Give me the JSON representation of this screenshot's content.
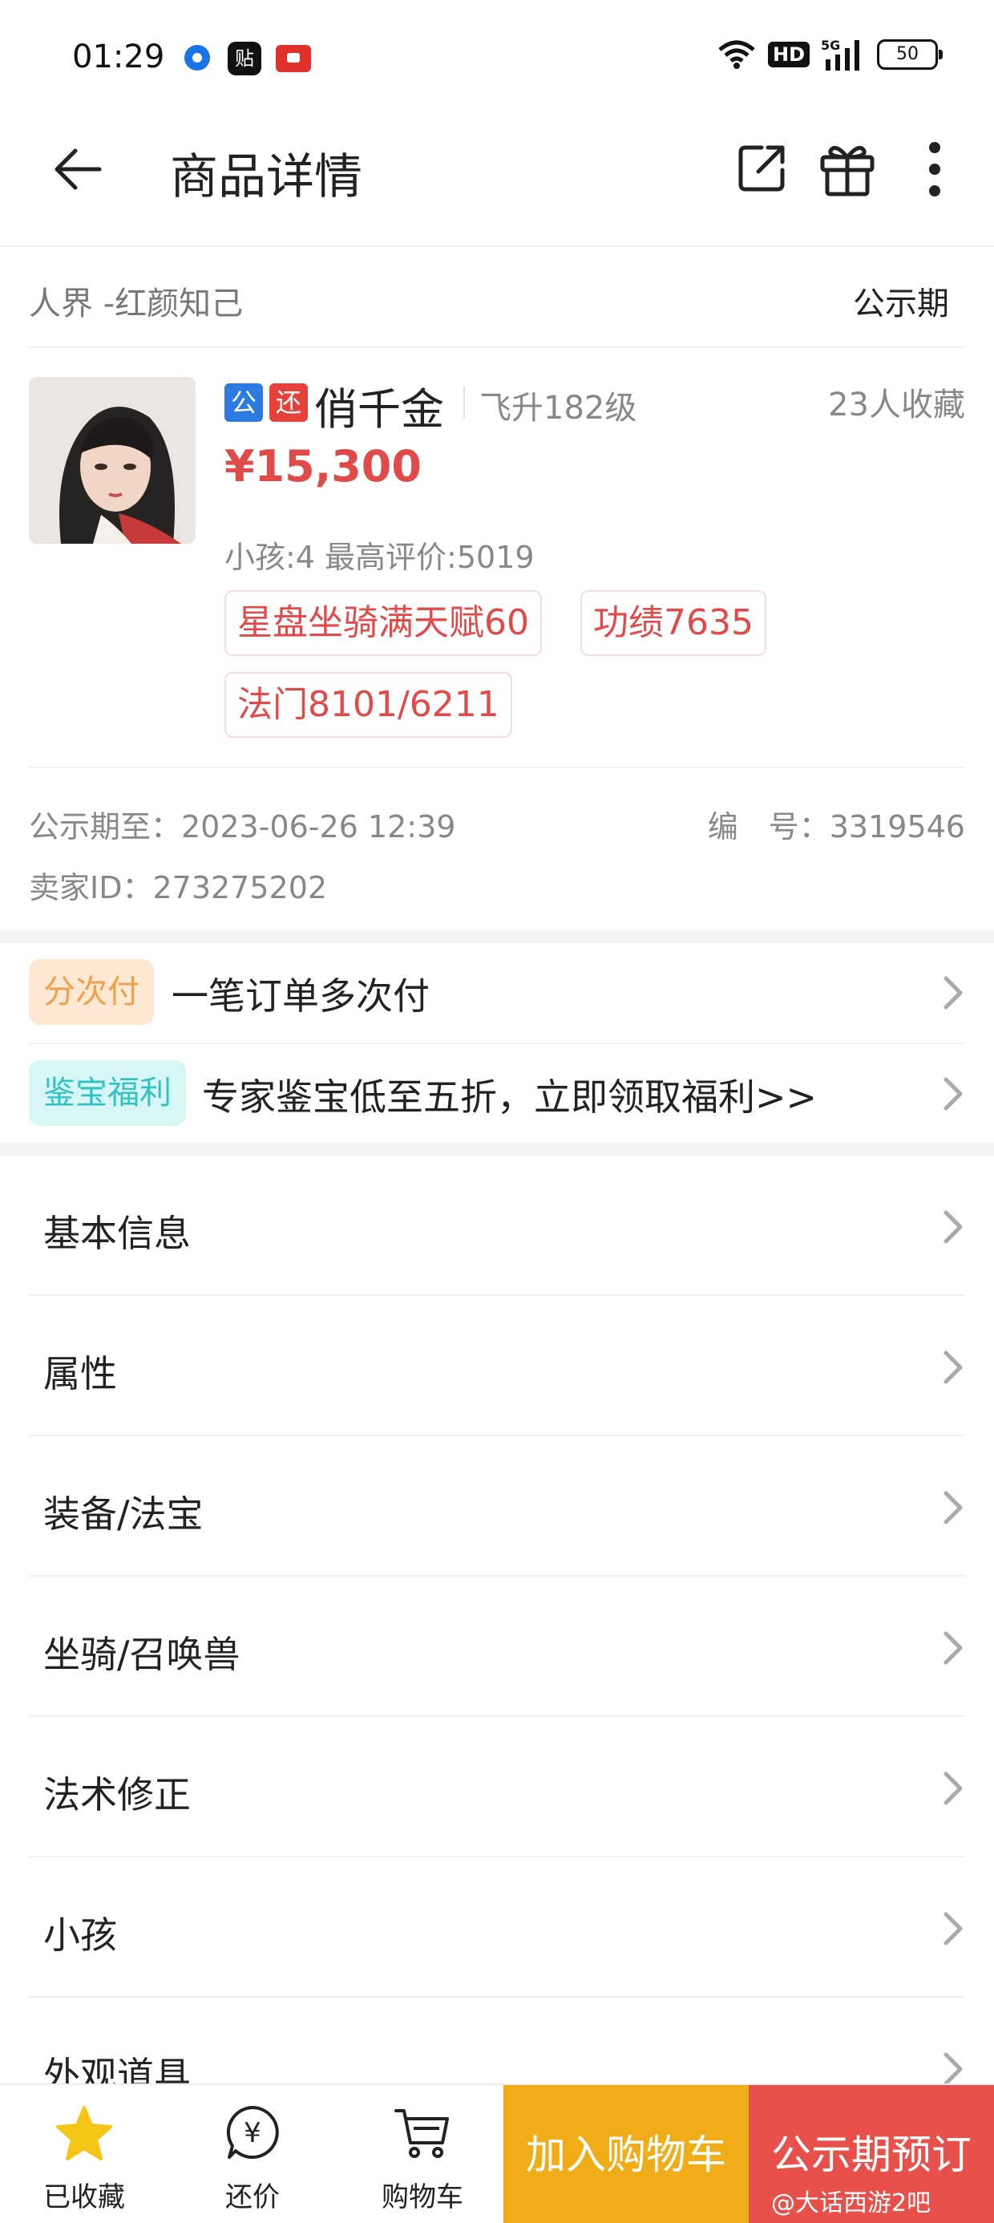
{
  "status_bar": {
    "time": "01:29",
    "tieba_glyph": "贴",
    "hd_label": "HD",
    "net_label": "5G",
    "battery": "50"
  },
  "nav": {
    "title": "商品详情",
    "icons": [
      "back-arrow-icon",
      "share-icon",
      "gift-icon",
      "more-vertical-icon"
    ]
  },
  "server_row": {
    "server_name": "人界 -红颜知己",
    "status": "公示期"
  },
  "product": {
    "tag_public": "公",
    "tag_bargain": "还",
    "role_name": "俏千金",
    "role_level": "飞升182级",
    "favorites": "23人收藏",
    "price": "¥15,300",
    "meta": "小孩:4 最高评价:5019",
    "chips": [
      "星盘坐骑满天赋60",
      "功绩7635",
      "法门8101/6211"
    ],
    "public_until": "公示期至：2023-06-26 12:39",
    "serial": "编　号：3319546",
    "seller_id": "卖家ID：273275202"
  },
  "promos": [
    {
      "badge": "分次付",
      "text": "一笔订单多次付"
    },
    {
      "badge": "鉴宝福利",
      "text": "专家鉴宝低至五折，立即领取福利>>"
    }
  ],
  "menu": [
    "基本信息",
    "属性",
    "装备/法宝",
    "坐骑/召唤兽",
    "法术修正",
    "小孩",
    "外观道具"
  ],
  "bottom_bar": {
    "favorited": "已收藏",
    "bargain": "还价",
    "yen_glyph": "¥",
    "cart": "购物车",
    "add_to_cart": "加入购物车",
    "reserve": "公示期预订",
    "watermark": "@大话西游2吧"
  },
  "colors": {
    "price_red": "#e24a4a",
    "cart_orange": "#f0ad18",
    "reserve_red": "#e8504b",
    "tag_blue": "#2d7be0",
    "star_yellow": "#f5c518"
  }
}
